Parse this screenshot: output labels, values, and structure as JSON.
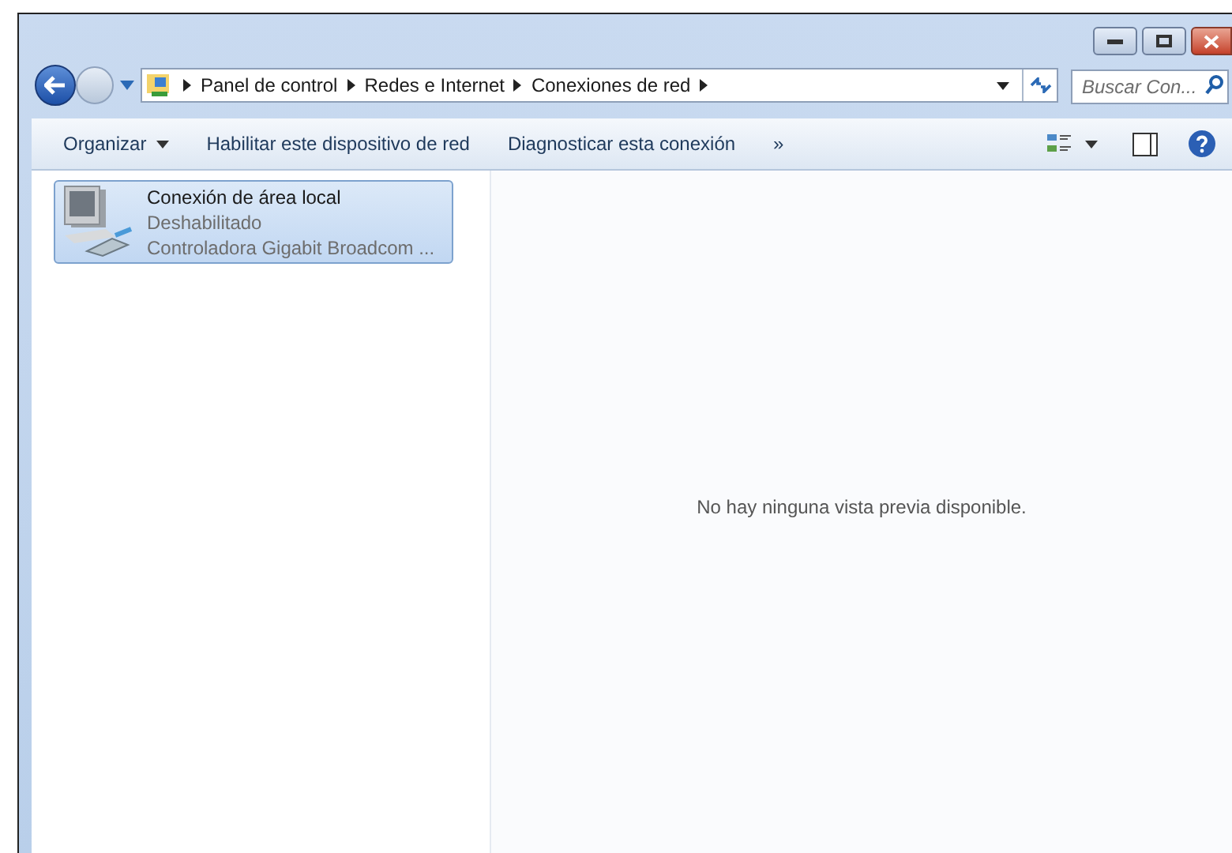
{
  "address_bar": {
    "breadcrumbs": [
      "Panel de control",
      "Redes e Internet",
      "Conexiones de red"
    ]
  },
  "search": {
    "placeholder": "Buscar Con..."
  },
  "toolbar": {
    "items": [
      {
        "label": "Organizar",
        "dropdown": true
      },
      {
        "label": "Habilitar este dispositivo de red",
        "dropdown": false
      },
      {
        "label": "Diagnosticar esta conexión",
        "dropdown": false
      },
      {
        "label": "»",
        "dropdown": false
      }
    ]
  },
  "connections": [
    {
      "name": "Conexión de área local",
      "status": "Deshabilitado",
      "device": "Controladora Gigabit Broadcom ...",
      "selected": true
    }
  ],
  "preview": {
    "message": "No hay ninguna vista previa disponible."
  }
}
